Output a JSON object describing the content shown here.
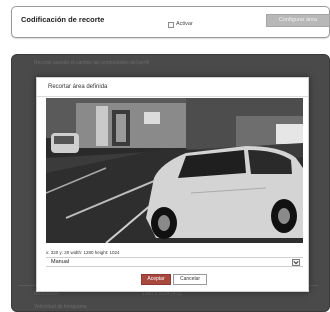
{
  "crop_encoding": {
    "title": "Codificación de recorte",
    "enable_label": "Activar",
    "configure_button": "Configurar área"
  },
  "background": {
    "line1": "Recorte usando el cambio las propiedades del perfil",
    "row_label_a": "Resolución",
    "row_value_a": "1280 x 1024 (4:3)",
    "row_label_b": "Velocidad de fotograma"
  },
  "dialog": {
    "title": "Recortar área definida",
    "coords": "x: 320 y: 20 width: 1280 height: 1024",
    "mode_value": "Manual",
    "ok_button": "Aceptar",
    "cancel_button": "Cancelar"
  },
  "colors": {
    "accent": "#a7493f",
    "overlay": "#4a4a4a",
    "disabled_button": "#b8b8b8"
  }
}
